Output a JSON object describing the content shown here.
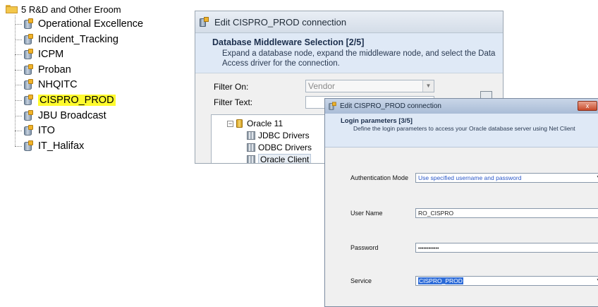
{
  "tree": {
    "root_label": "5 R&D and Other Eroom",
    "items": [
      {
        "label": "Operational Excellence",
        "highlighted": false
      },
      {
        "label": "Incident_Tracking",
        "highlighted": false
      },
      {
        "label": "ICPM",
        "highlighted": false
      },
      {
        "label": "Proban",
        "highlighted": false
      },
      {
        "label": "NHQITC",
        "highlighted": false
      },
      {
        "label": "CISPRO_PROD",
        "highlighted": true
      },
      {
        "label": "JBU Broadcast",
        "highlighted": false
      },
      {
        "label": "ITO",
        "highlighted": false
      },
      {
        "label": "IT_Halifax",
        "highlighted": false
      }
    ],
    "highlight_color": "#fffb2e"
  },
  "back_window": {
    "title": "Edit CISPRO_PROD connection",
    "header_title": "Database Middleware Selection [2/5]",
    "header_desc": "Expand a database node, expand the middleware node, and select the Data Access driver for the connection.",
    "filter_on_label": "Filter On:",
    "filter_on_value": "Vendor",
    "filter_text_label": "Filter Text:",
    "tree": {
      "node": "Oracle 11",
      "children": [
        "JDBC Drivers",
        "ODBC Drivers",
        "Oracle Client"
      ],
      "selected": "Oracle Client"
    }
  },
  "front_window": {
    "title": "Edit CISPRO_PROD connection",
    "header_title": "Login parameters [3/5]",
    "header_desc": "Define the login parameters to access your Oracle database server using Net Client",
    "fields": {
      "auth_mode": {
        "label": "Authentication Mode",
        "value": "Use specified username and password"
      },
      "user_name": {
        "label": "User Name",
        "value": "RO_CISPRO"
      },
      "password": {
        "label": "Password",
        "value": "••••••••••••"
      },
      "service": {
        "label": "Service",
        "value": "CISPRO_PROD"
      }
    },
    "close_glyph": "x"
  }
}
